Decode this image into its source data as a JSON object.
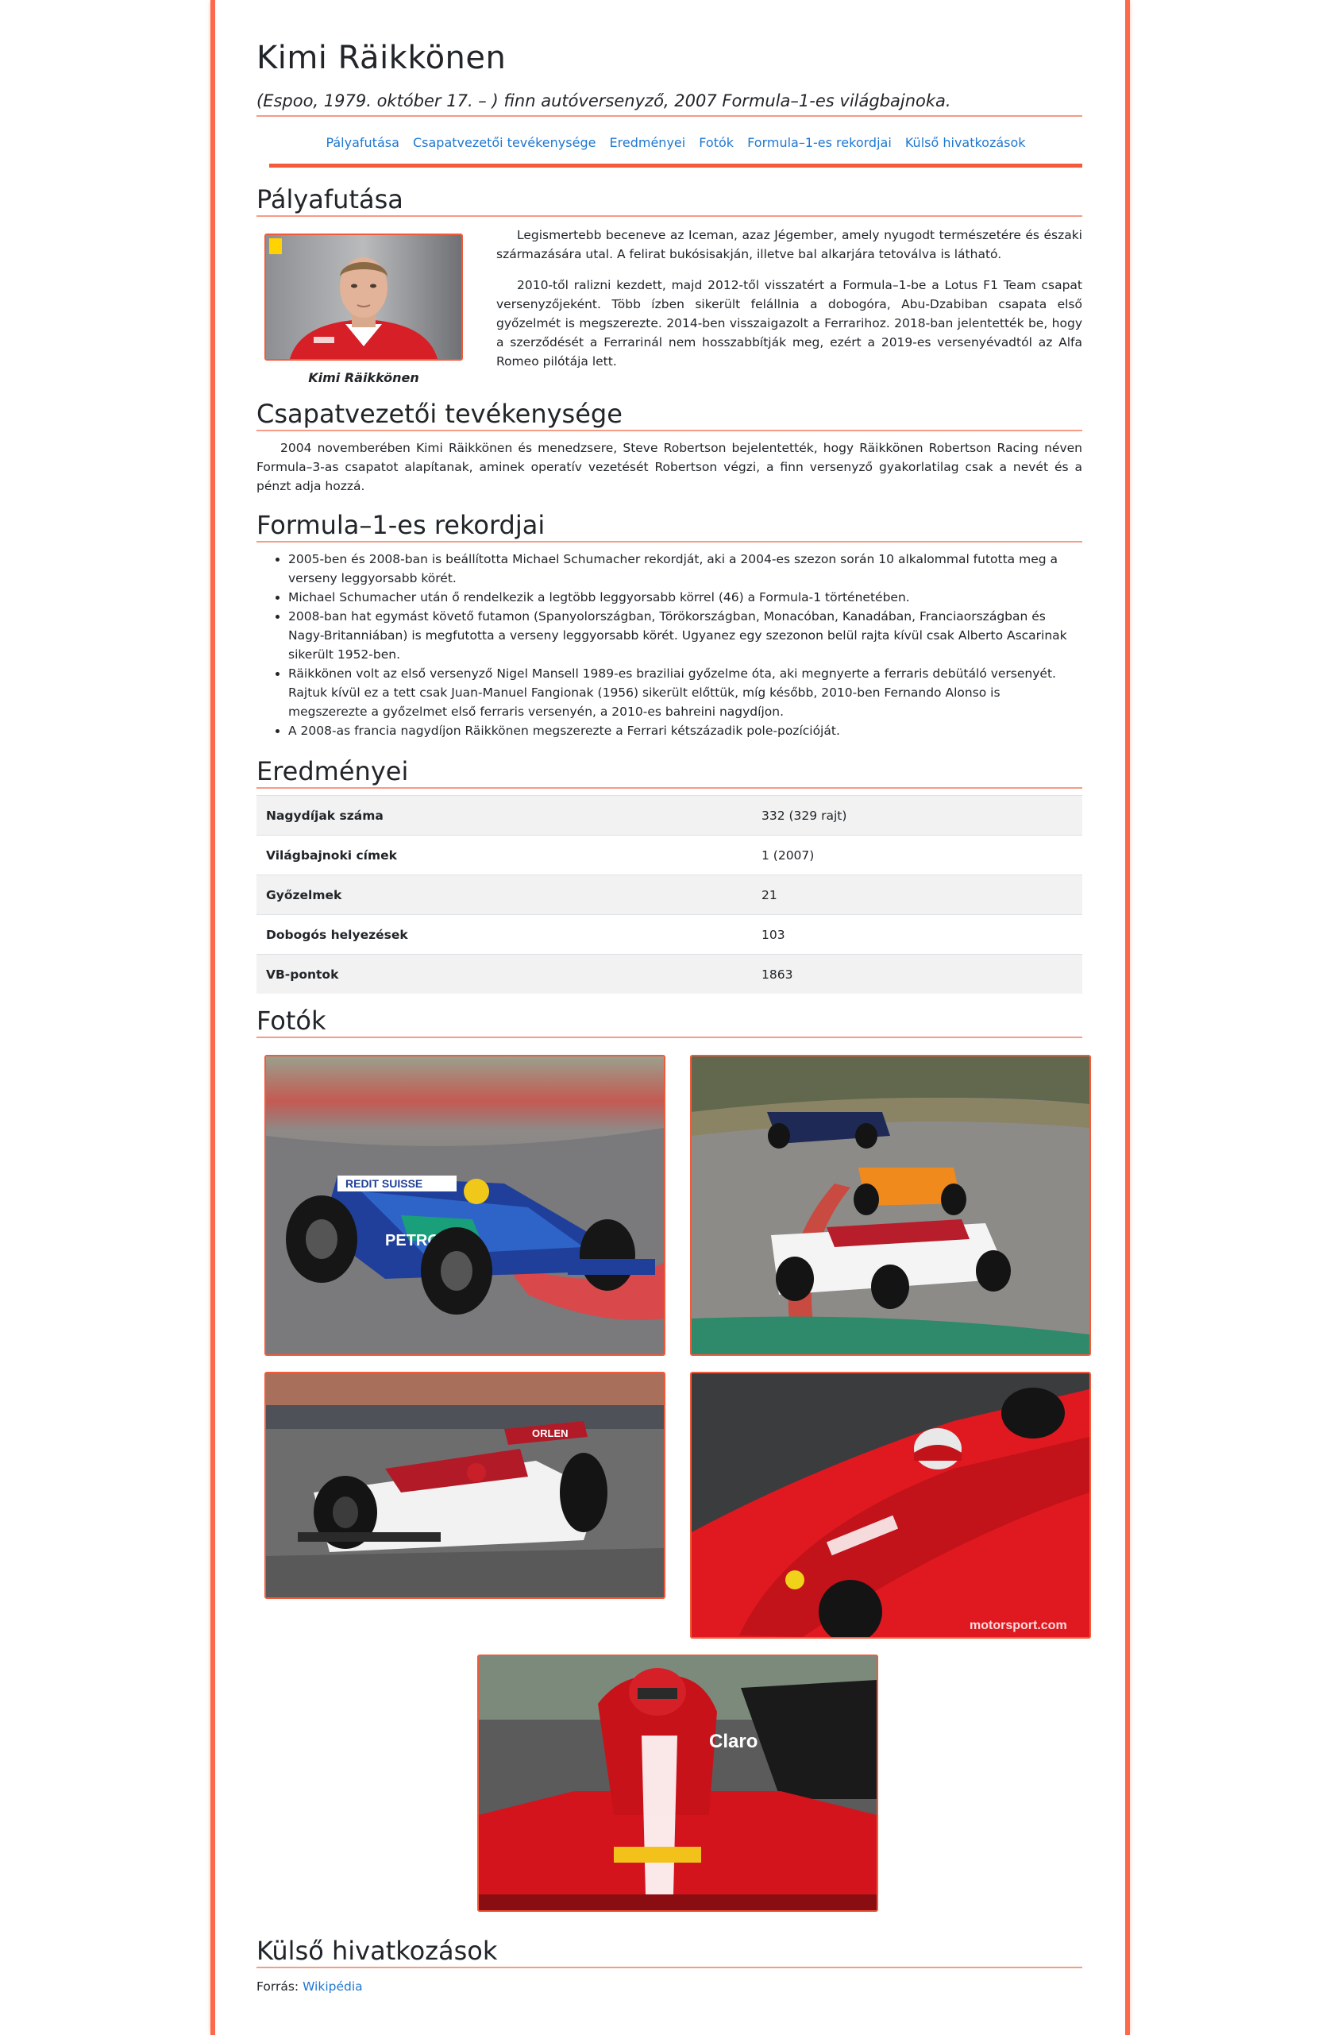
{
  "title": "Kimi Räikkönen",
  "subtitle": "(Espoo, 1979. október 17. – ) finn autóversenyző, 2007 Formula–1-es világbajnoka.",
  "nav": [
    "Pályafutása",
    "Csapatvezetői tevékenysége",
    "Eredményei",
    "Fotók",
    "Formula–1-es rekordjai",
    "Külső hivatkozások"
  ],
  "career": {
    "heading": "Pályafutása",
    "caption": "Kimi Räikkönen",
    "paragraphs": [
      "Legismertebb beceneve az Iceman, azaz Jégember, amely nyugodt természetére és északi származására utal. A felirat bukósisakján, illetve bal alkarjára tetoválva is látható.",
      "2010-től ralizni kezdett, majd 2012-től visszatért a Formula–1-be a Lotus F1 Team csapat versenyzőjeként. Több ízben sikerült felállnia a dobogóra, Abu-Dzabiban csapata első győzelmét is megszerezte. 2014-ben visszaigazolt a Ferrarihoz. 2018-ban jelentették be, hogy a szerződését a Ferrarinál nem hosszabbítják meg, ezért a 2019-es versenyévadtól az Alfa Romeo pilótája lett."
    ]
  },
  "team": {
    "heading": "Csapatvezetői tevékenysége",
    "text": "2004 novemberében Kimi Räikkönen és menedzsere, Steve Robertson bejelentették, hogy Räikkönen Robertson Racing néven Formula–3-as csapatot alapítanak, aminek operatív vezetését Robertson végzi, a finn versenyző gyakorlatilag csak a nevét és a pénzt adja hozzá."
  },
  "records": {
    "heading": "Formula–1-es rekordjai",
    "items": [
      "2005-ben és 2008-ban is beállította Michael Schumacher rekordját, aki a 2004-es szezon során 10 alkalommal futotta meg a verseny leggyorsabb körét.",
      "Michael Schumacher után ő rendelkezik a legtöbb leggyorsabb körrel (46) a Formula-1 történetében.",
      "2008-ban hat egymást követő futamon (Spanyolországban, Törökországban, Monacóban, Kanadában, Franciaországban és Nagy-Britanniában) is megfutotta a verseny leggyorsabb körét. Ugyanez egy szezonon belül rajta kívül csak Alberto Ascarinak sikerült 1952-ben.",
      "Räikkönen volt az első versenyző Nigel Mansell 1989-es braziliai győzelme óta, aki megnyerte a ferraris debütáló versenyét. Rajtuk kívül ez a tett csak Juan-Manuel Fangionak (1956) sikerült előttük, míg később, 2010-ben Fernando Alonso is megszerezte a győzelmet első ferraris versenyén, a 2010-es bahreini nagydíjon.",
      "A 2008-as francia nagydíjon Räikkönen megszerezte a Ferrari kétszázadik pole-pozícióját."
    ]
  },
  "results": {
    "heading": "Eredményei",
    "rows": [
      {
        "label": "Nagydíjak száma",
        "value": "332 (329 rajt)"
      },
      {
        "label": "Világbajnoki címek",
        "value": "1 (2007)"
      },
      {
        "label": "Győzelmek",
        "value": "21"
      },
      {
        "label": "Dobogós helyezések",
        "value": "103"
      },
      {
        "label": "VB-pontok",
        "value": "1863"
      }
    ]
  },
  "photos": {
    "heading": "Fotók",
    "watermark": "motorsport.com",
    "car1_text": [
      "REDIT SUISSE",
      "PETRONAS"
    ],
    "car3_text": "ORLEN",
    "car5_text": "Claro"
  },
  "links": {
    "heading": "Külső hivatkozások",
    "source_label": "Forrás:",
    "source_link": "Wikipédia"
  },
  "colors": {
    "accent": "#f25a3a",
    "link": "#1e77d1"
  }
}
